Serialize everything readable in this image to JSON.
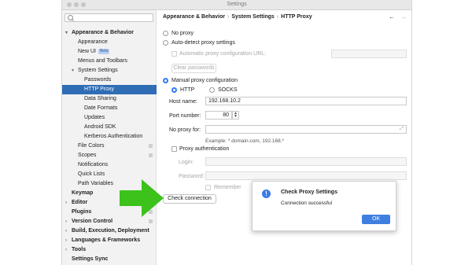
{
  "window": {
    "title": "Settings"
  },
  "search": {
    "placeholder": ""
  },
  "sidebar": {
    "items": [
      {
        "label": "Appearance & Behavior",
        "expanded": true
      },
      {
        "label": "Appearance"
      },
      {
        "label": "New UI",
        "badge": "Beta"
      },
      {
        "label": "Menus and Toolbars"
      },
      {
        "label": "System Settings",
        "expanded": true
      },
      {
        "label": "Passwords"
      },
      {
        "label": "HTTP Proxy",
        "selected": true
      },
      {
        "label": "Data Sharing"
      },
      {
        "label": "Date Formats"
      },
      {
        "label": "Updates"
      },
      {
        "label": "Android SDK"
      },
      {
        "label": "Kerberos Authentication"
      },
      {
        "label": "File Colors"
      },
      {
        "label": "Scopes"
      },
      {
        "label": "Notifications"
      },
      {
        "label": "Quick Lists"
      },
      {
        "label": "Path Variables"
      },
      {
        "label": "Keymap"
      },
      {
        "label": "Editor"
      },
      {
        "label": "Plugins"
      },
      {
        "label": "Version Control"
      },
      {
        "label": "Build, Execution, Deployment"
      },
      {
        "label": "Languages & Frameworks"
      },
      {
        "label": "Tools"
      },
      {
        "label": "Settings Sync"
      }
    ]
  },
  "breadcrumb": {
    "part1": "Appearance & Behavior",
    "part2": "System Settings",
    "part3": "HTTP Proxy",
    "separator": "›"
  },
  "nav": {
    "back": "←",
    "forward": "→"
  },
  "proxy": {
    "no_proxy": "No proxy",
    "auto_detect": "Auto-detect proxy settings",
    "auto_config_url": "Automatic proxy configuration URL:",
    "clear_passwords": "Clear passwords",
    "manual": "Manual proxy configuration",
    "http": "HTTP",
    "socks": "SOCKS",
    "host_label": "Host name:",
    "host_value": "192.168.10.2",
    "port_label": "Port number:",
    "port_value": "80",
    "no_proxy_for_label": "No proxy for:",
    "no_proxy_for_value": "",
    "example": "Example: *.domain.com, 192.168.*",
    "proxy_auth": "Proxy authentication",
    "login_label": "Login:",
    "password_label": "Password:",
    "remember": "Remember",
    "check_connection": "Check connection"
  },
  "dialog": {
    "title": "Check Proxy Settings",
    "message": "Connection successful",
    "ok": "OK",
    "icon": "info-icon"
  },
  "colors": {
    "selection": "#2f6db5",
    "accent": "#3478f6",
    "arrow": "#3cc21b"
  }
}
